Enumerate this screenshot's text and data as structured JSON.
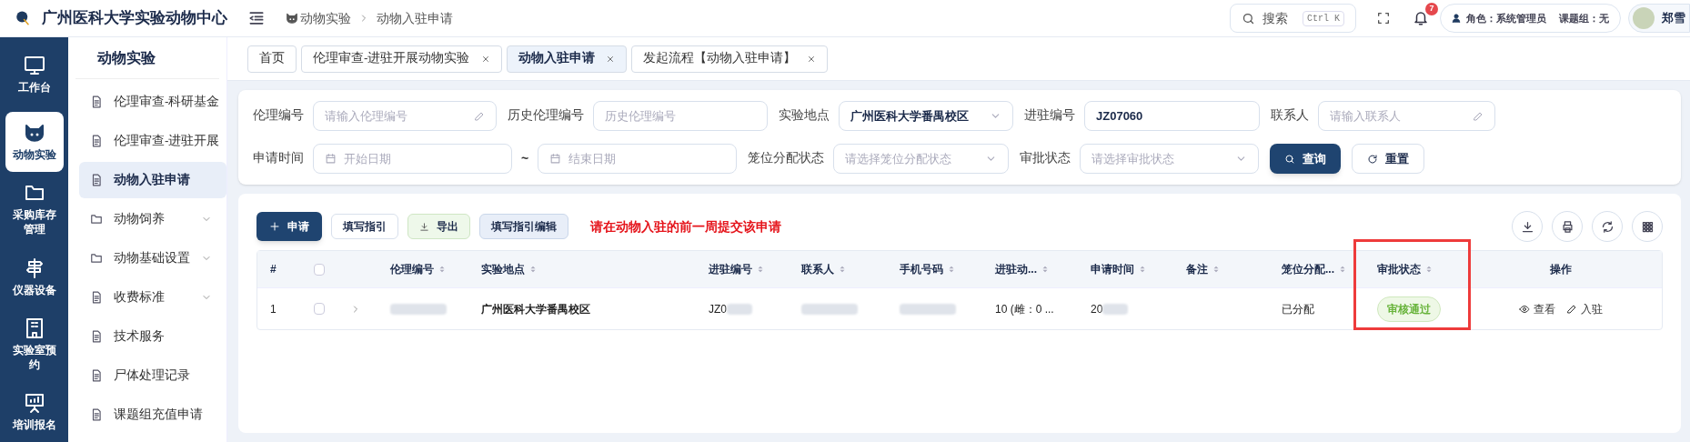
{
  "header": {
    "logo_title": "广州医科大学实验动物中心",
    "breadcrumb": [
      "动物实验",
      "动物入驻申请"
    ],
    "search": {
      "label": "搜索",
      "shortcut": "Ctrl K"
    },
    "notification_count": "7",
    "role": "角色：系统管理员",
    "group": "课题组：无",
    "user": "郑雪"
  },
  "nav_rail": [
    {
      "label": "工作台",
      "selected": false
    },
    {
      "label": "动物实验",
      "selected": true
    },
    {
      "label": "采购库存管理",
      "selected": false
    },
    {
      "label": "仪器设备",
      "selected": false
    },
    {
      "label": "实验室预约",
      "selected": false
    },
    {
      "label": "培训报名",
      "selected": false
    }
  ],
  "sidebar": {
    "title": "动物实验",
    "items": [
      {
        "label": "伦理审查-科研基金",
        "kind": "page",
        "selected": false
      },
      {
        "label": "伦理审查-进驻开展",
        "kind": "page",
        "selected": false
      },
      {
        "label": "动物入驻申请",
        "kind": "page",
        "selected": true
      },
      {
        "label": "动物饲养",
        "kind": "folder",
        "expanded": false
      },
      {
        "label": "动物基础设置",
        "kind": "folder",
        "expanded": false
      },
      {
        "label": "收费标准",
        "kind": "section",
        "expanded": false
      },
      {
        "label": "技术服务",
        "kind": "page",
        "selected": false
      },
      {
        "label": "尸体处理记录",
        "kind": "page",
        "selected": false
      },
      {
        "label": "课题组充值申请",
        "kind": "page",
        "selected": false
      }
    ]
  },
  "tabs": [
    {
      "label": "首页",
      "closable": false,
      "selected": false
    },
    {
      "label": "伦理审查-进驻开展动物实验",
      "closable": true,
      "selected": false
    },
    {
      "label": "动物入驻申请",
      "closable": true,
      "selected": true
    },
    {
      "label": "发起流程【动物入驻申请】",
      "closable": true,
      "selected": false
    }
  ],
  "filters": [
    [
      {
        "label": "伦理编号",
        "kind": "text",
        "placeholder": "请输入伦理编号",
        "edit_icon": true
      },
      {
        "label": "历史伦理编号",
        "kind": "text",
        "placeholder": "历史伦理编号",
        "edit_icon": false
      },
      {
        "label": "实验地点",
        "kind": "select",
        "value": "广州医科大学番禺校区"
      },
      {
        "label": "进驻编号",
        "kind": "text",
        "value": "JZ07060",
        "edit_icon": false
      },
      {
        "label": "联系人",
        "kind": "text",
        "placeholder": "请输入联系人",
        "edit_icon": true
      }
    ],
    [
      {
        "label": "申请时间",
        "kind": "daterange",
        "start_placeholder": "开始日期",
        "separator": "~",
        "end_placeholder": "结束日期"
      },
      {
        "label": "笼位分配状态",
        "kind": "select",
        "placeholder": "请选择笼位分配状态"
      },
      {
        "label": "审批状态",
        "kind": "select",
        "placeholder": "请选择审批状态"
      }
    ]
  ],
  "filter_buttons": [
    {
      "label": "查询",
      "kind": "primary"
    },
    {
      "label": "重置",
      "kind": "reset"
    }
  ],
  "toolbar": {
    "buttons": [
      {
        "label": "申请",
        "kind": "primary"
      },
      {
        "label": "填写指引",
        "kind": "default"
      },
      {
        "label": "导出",
        "kind": "success"
      },
      {
        "label": "填写指引编辑",
        "kind": "info"
      }
    ],
    "notice": "请在动物入驻的前一周提交该申请"
  },
  "table": {
    "select_all_checked": false,
    "columns": [
      {
        "label": "#",
        "sortable": false,
        "highlighted": false
      },
      {
        "label": "伦理编号",
        "sortable": true,
        "highlighted": false
      },
      {
        "label": "实验地点",
        "sortable": true,
        "highlighted": false
      },
      {
        "label": "进驻编号",
        "sortable": true,
        "highlighted": false
      },
      {
        "label": "联系人",
        "sortable": true,
        "highlighted": false
      },
      {
        "label": "手机号码",
        "sortable": true,
        "highlighted": false
      },
      {
        "label": "进驻动...",
        "sortable": true,
        "highlighted": false
      },
      {
        "label": "申请时间",
        "sortable": true,
        "highlighted": false
      },
      {
        "label": "备注",
        "sortable": true,
        "highlighted": false
      },
      {
        "label": "笼位分配...",
        "sortable": true,
        "highlighted": false
      },
      {
        "label": "审批状态",
        "sortable": true,
        "highlighted": true
      },
      {
        "label": "操作",
        "sortable": false,
        "highlighted": false
      }
    ],
    "rows": [
      {
        "checked": false,
        "expanded": false,
        "cells": [
          {
            "kind": "text",
            "text": "1"
          },
          {
            "kind": "blurred"
          },
          {
            "kind": "text",
            "text": "广州医科大学番禺校区"
          },
          {
            "kind": "partial",
            "text": "JZ0"
          },
          {
            "kind": "blurred"
          },
          {
            "kind": "blurred"
          },
          {
            "kind": "text",
            "text": "10 (雌：0 ..."
          },
          {
            "kind": "partial",
            "text": "20"
          },
          {
            "kind": "empty"
          },
          {
            "kind": "text",
            "text": "已分配"
          },
          {
            "kind": "tag",
            "text": "审核通过"
          },
          {
            "kind": "actions",
            "actions": [
              {
                "label": "查看"
              },
              {
                "label": "入驻"
              }
            ]
          }
        ]
      }
    ]
  }
}
